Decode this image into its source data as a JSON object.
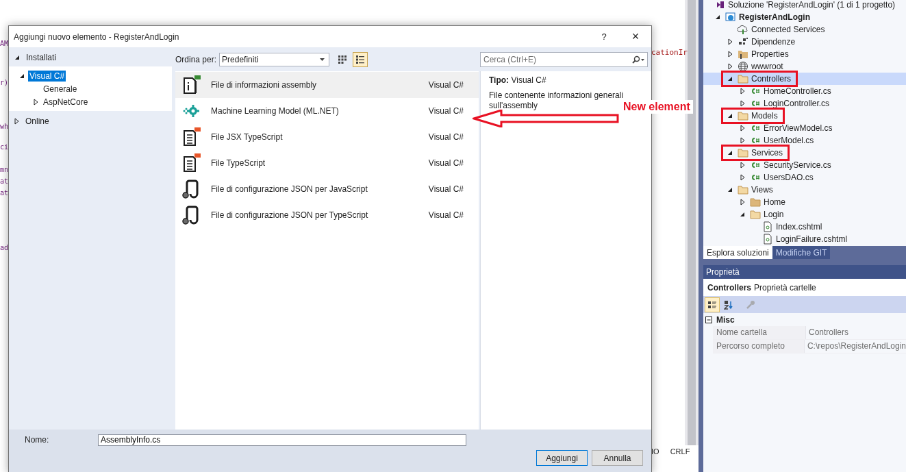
{
  "editor": {
    "fragments": [
      "AM",
      "r)",
      "wh",
      "ci",
      "mn",
      "at",
      "at",
      "ad"
    ],
    "right_fragment": "cationIr",
    "status": [
      "IO",
      "CRLF"
    ]
  },
  "dialog": {
    "title": "Aggiungi nuovo elemento - RegisterAndLogin",
    "help": "?",
    "close": "×",
    "categories": [
      {
        "label": "Installati",
        "expanded": true,
        "children": [
          {
            "label": "Visual C#",
            "selected": true,
            "expanded": true,
            "children": [
              {
                "label": "Generale",
                "selected": false
              },
              {
                "label": "AspNetCore",
                "selected": false,
                "expanded": false
              }
            ]
          }
        ]
      },
      {
        "label": "Online",
        "expanded": false
      }
    ],
    "sort": {
      "label": "Ordina per:",
      "value": "Predefiniti"
    },
    "views": [
      {
        "kind": "grid",
        "selected": false
      },
      {
        "kind": "list",
        "selected": true
      }
    ],
    "search": {
      "placeholder": "Cerca (Ctrl+E)"
    },
    "templates": [
      {
        "kind": "info",
        "name": "File di informazioni assembly",
        "language": "Visual C#",
        "selected": true
      },
      {
        "kind": "ml",
        "name": "Machine Learning Model (ML.NET)",
        "language": "Visual C#",
        "selected": false
      },
      {
        "kind": "ts",
        "name": "File JSX TypeScript",
        "language": "Visual C#",
        "selected": false
      },
      {
        "kind": "ts",
        "name": "File TypeScript",
        "language": "Visual C#",
        "selected": false
      },
      {
        "kind": "json",
        "name": "File di configurazione JSON per JavaScript",
        "language": "Visual C#",
        "selected": false
      },
      {
        "kind": "json",
        "name": "File di configurazione JSON per TypeScript",
        "language": "Visual C#",
        "selected": false
      }
    ],
    "details": {
      "type_label": "Tipo:",
      "type_value": "Visual C#",
      "description": "File contenente informazioni generali sull'assembly"
    },
    "name_field": {
      "label": "Nome:",
      "value": "AssemblyInfo.cs"
    },
    "buttons": [
      {
        "label": "Aggiungi",
        "default": true
      },
      {
        "label": "Annulla",
        "default": false
      }
    ]
  },
  "annotation": {
    "text": "New element"
  },
  "explorer": {
    "solution": "Soluzione 'RegisterAndLogin' (1 di 1 progetto)",
    "tree": [
      {
        "label": "RegisterAndLogin",
        "kind": "project",
        "selected": false,
        "expanded": true,
        "children": [
          {
            "label": "Connected Services",
            "kind": "connected",
            "selected": false,
            "highlighted": false
          },
          {
            "label": "Dipendenze",
            "kind": "dependencies",
            "selected": false,
            "highlighted": false,
            "expanded": false
          },
          {
            "label": "Properties",
            "kind": "properties",
            "selected": false,
            "highlighted": false,
            "expanded": false
          },
          {
            "label": "wwwroot",
            "kind": "globe",
            "selected": false,
            "highlighted": false,
            "expanded": false
          },
          {
            "label": "Controllers",
            "kind": "folder",
            "selected": true,
            "highlighted": true,
            "expanded": true,
            "children": [
              {
                "label": "HomeController.cs",
                "kind": "csharp",
                "selected": false,
                "expanded": false
              },
              {
                "label": "LoginController.cs",
                "kind": "csharp",
                "selected": false,
                "expanded": false
              }
            ]
          },
          {
            "label": "Models",
            "kind": "folder",
            "selected": false,
            "highlighted": true,
            "expanded": true,
            "children": [
              {
                "label": "ErrorViewModel.cs",
                "kind": "csharp",
                "selected": false,
                "expanded": false
              },
              {
                "label": "UserModel.cs",
                "kind": "csharp",
                "selected": false,
                "expanded": false
              }
            ]
          },
          {
            "label": "Services",
            "kind": "folder",
            "selected": false,
            "highlighted": true,
            "expanded": true,
            "children": [
              {
                "label": "SecurityService.cs",
                "kind": "csharp",
                "selected": false,
                "expanded": false
              },
              {
                "label": "UsersDAO.cs",
                "kind": "csharp",
                "selected": false,
                "expanded": false
              }
            ]
          },
          {
            "label": "Views",
            "kind": "folder",
            "selected": false,
            "highlighted": false,
            "expanded": true,
            "children": [
              {
                "label": "Home",
                "kind": "folder",
                "selected": false,
                "expanded": false
              },
              {
                "label": "Login",
                "kind": "folder",
                "selected": false,
                "expanded": true,
                "children": [
                  {
                    "label": "Index.cshtml",
                    "kind": "cshtml",
                    "selected": false
                  },
                  {
                    "label": "LoginFailure.cshtml",
                    "kind": "cshtml",
                    "selected": false
                  }
                ]
              }
            ]
          }
        ]
      }
    ],
    "tabs": [
      {
        "label": "Esplora soluzioni",
        "selected": true
      },
      {
        "label": "Modifiche GIT",
        "selected": false
      }
    ]
  },
  "properties": {
    "title": "Proprietà",
    "object": "Controllers",
    "object_type": "Proprietà cartelle",
    "tools": [
      {
        "kind": "categorized",
        "selected": true,
        "disabled": false
      },
      {
        "kind": "alphabetical",
        "selected": false,
        "disabled": false
      },
      {
        "kind": "wrench",
        "selected": false,
        "disabled": true
      }
    ],
    "category": {
      "label": "Misc",
      "expanded": true
    },
    "rows": [
      {
        "name": "Nome cartella",
        "value": "Controllers"
      },
      {
        "name": "Percorso completo",
        "value": "C:\\repos\\RegisterAndLogin"
      }
    ]
  }
}
